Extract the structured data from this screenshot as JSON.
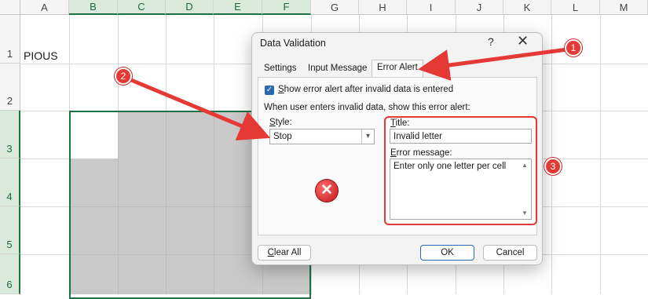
{
  "sheet": {
    "columns": [
      "A",
      "B",
      "C",
      "D",
      "E",
      "F",
      "G",
      "H",
      "I",
      "J",
      "K",
      "L",
      "M"
    ],
    "rows": [
      "1",
      "2",
      "3",
      "4",
      "5",
      "6"
    ],
    "cell_a1": "PIOUS"
  },
  "dialog": {
    "title": "Data Validation",
    "help": "?",
    "close": "✕",
    "tabs": [
      "Settings",
      "Input Message",
      "Error Alert"
    ],
    "show_alert_label": "Show error alert after invalid data is entered",
    "show_alert_checked": true,
    "when_label": "When user enters invalid data, show this error alert:",
    "style_label": "Style:",
    "style_value": "Stop",
    "title_label": "Title:",
    "title_value": "Invalid letter",
    "error_label": "Error message:",
    "error_value": "Enter only one letter per cell",
    "clear_all": "Clear All",
    "ok": "OK",
    "cancel": "Cancel",
    "stop_icon": "stop-x-icon"
  },
  "annotations": [
    "1",
    "2",
    "3"
  ],
  "colors": {
    "accent_green": "#1e7145",
    "annotation_red": "#e53935",
    "checkbox_blue": "#2a67b5"
  }
}
